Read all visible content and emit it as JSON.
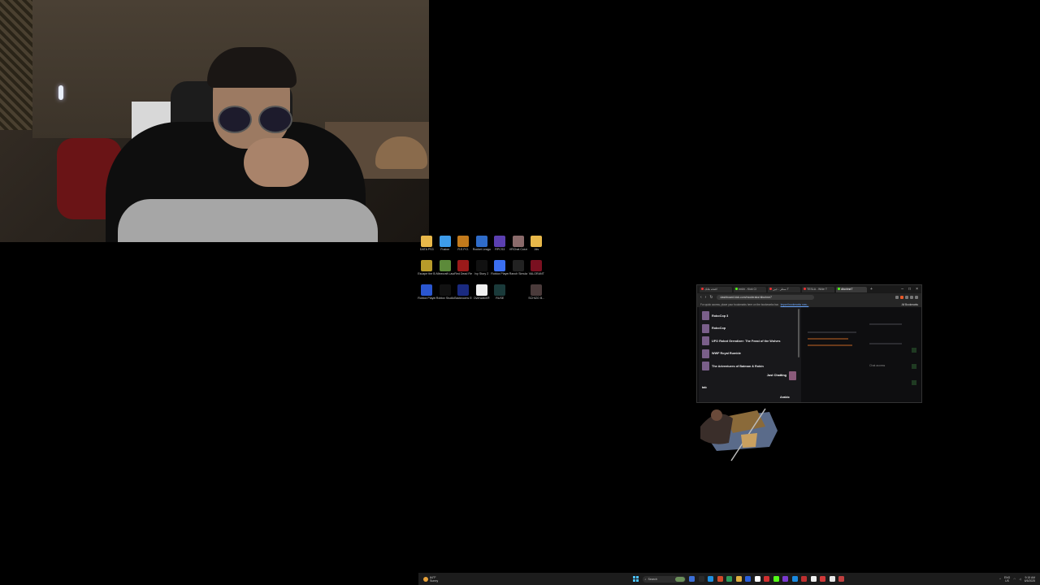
{
  "desktop_icons": [
    {
      "label": "DATA PS3",
      "icon": "folder-icon",
      "color": "#e8b84a"
    },
    {
      "label": "Fusion",
      "icon": "fusion-app-icon",
      "color": "#3d9be9"
    },
    {
      "label": "R.E.P.O.",
      "icon": "repo-game-icon",
      "color": "#c27a1c"
    },
    {
      "label": "Rocket League®",
      "icon": "rocket-league-icon",
      "color": "#2f6cc9"
    },
    {
      "label": "RPCS3",
      "icon": "rpcs3-icon",
      "color": "#5b3fb0"
    },
    {
      "label": "VRChat Cosmetic...",
      "icon": "vrchat-icon",
      "color": "#8a6a6a"
    },
    {
      "label": "Jds",
      "icon": "folder-icon",
      "color": "#e8b84a"
    },
    {
      "label": "Escape the Backrooms",
      "icon": "escape-backrooms-icon",
      "color": "#b89b2a"
    },
    {
      "label": "Minecraft Launcher",
      "icon": "minecraft-icon",
      "color": "#5c8a3a"
    },
    {
      "label": "Red Dead Redemption",
      "icon": "red-dead-icon",
      "color": "#9a1a1a"
    },
    {
      "label": "Ivy Story 2",
      "icon": "ivy-story-icon",
      "color": "#111"
    },
    {
      "label": "Roblox Player",
      "icon": "roblox-player-icon",
      "color": "#3b6ff0"
    },
    {
      "label": "Ranch Simulator",
      "icon": "ranch-simulator-icon",
      "color": "#222"
    },
    {
      "label": "VALORANT",
      "icon": "valorant-icon",
      "color": "#7a1020"
    },
    {
      "label": "Roblox Player",
      "icon": "roblox-studio-icon",
      "color": "#2a56d0"
    },
    {
      "label": "Roblox Studio",
      "icon": "music-note-icon",
      "color": "#111"
    },
    {
      "label": "Backrooms Escape T...",
      "icon": "backrooms-escape-icon",
      "color": "#1a2a80"
    },
    {
      "label": "Overwatch®",
      "icon": "overwatch-icon",
      "color": "#f0f0f0"
    },
    {
      "label": "RUSE",
      "icon": "ruse-icon",
      "color": "#1a3a3a"
    },
    {
      "label": "",
      "icon": "empty-slot",
      "color": "#000"
    },
    {
      "label": "SCHIZO B...",
      "icon": "schizo-game-icon",
      "color": "#4a3a3a"
    }
  ],
  "browser": {
    "tabs": [
      {
        "label": "افتحه هاتك",
        "color": "#e33"
      },
      {
        "label": "rmkh - Kick Cl",
        "color": "#53fc18"
      },
      {
        "label": "سطر - جين T",
        "color": "#e33"
      },
      {
        "label": "TESLA - Wide T",
        "color": "#e33"
      },
      {
        "label": "dbcrime7",
        "color": "#53fc18"
      }
    ],
    "url": "dashboard.kick.com/moderator/dbcrime7",
    "bookmarks_prompt": "For quick access, place your bookmarks here on the bookmarks bar.",
    "bookmarks_link": "Import bookmarks now...",
    "all_bookmarks": "All Bookmarks",
    "categories": [
      "RoboCop 3",
      "RoboCop",
      "UFO Robot Grendizer: The Feast of the Wolves",
      "WWF Royal Rumble",
      "The Adventures of Batman & Robin"
    ],
    "selected_category": "Just Chatting",
    "tags_label": "tab",
    "language": "Arabic",
    "right_panel_labels": [
      "Chat access"
    ]
  },
  "taskbar": {
    "weather_temp": "84°F",
    "weather_desc": "Sunny",
    "search_placeholder": "Search",
    "lang": "ENG",
    "lang_region": "US",
    "time": "9:15 AM",
    "date": "6/5/2025"
  }
}
